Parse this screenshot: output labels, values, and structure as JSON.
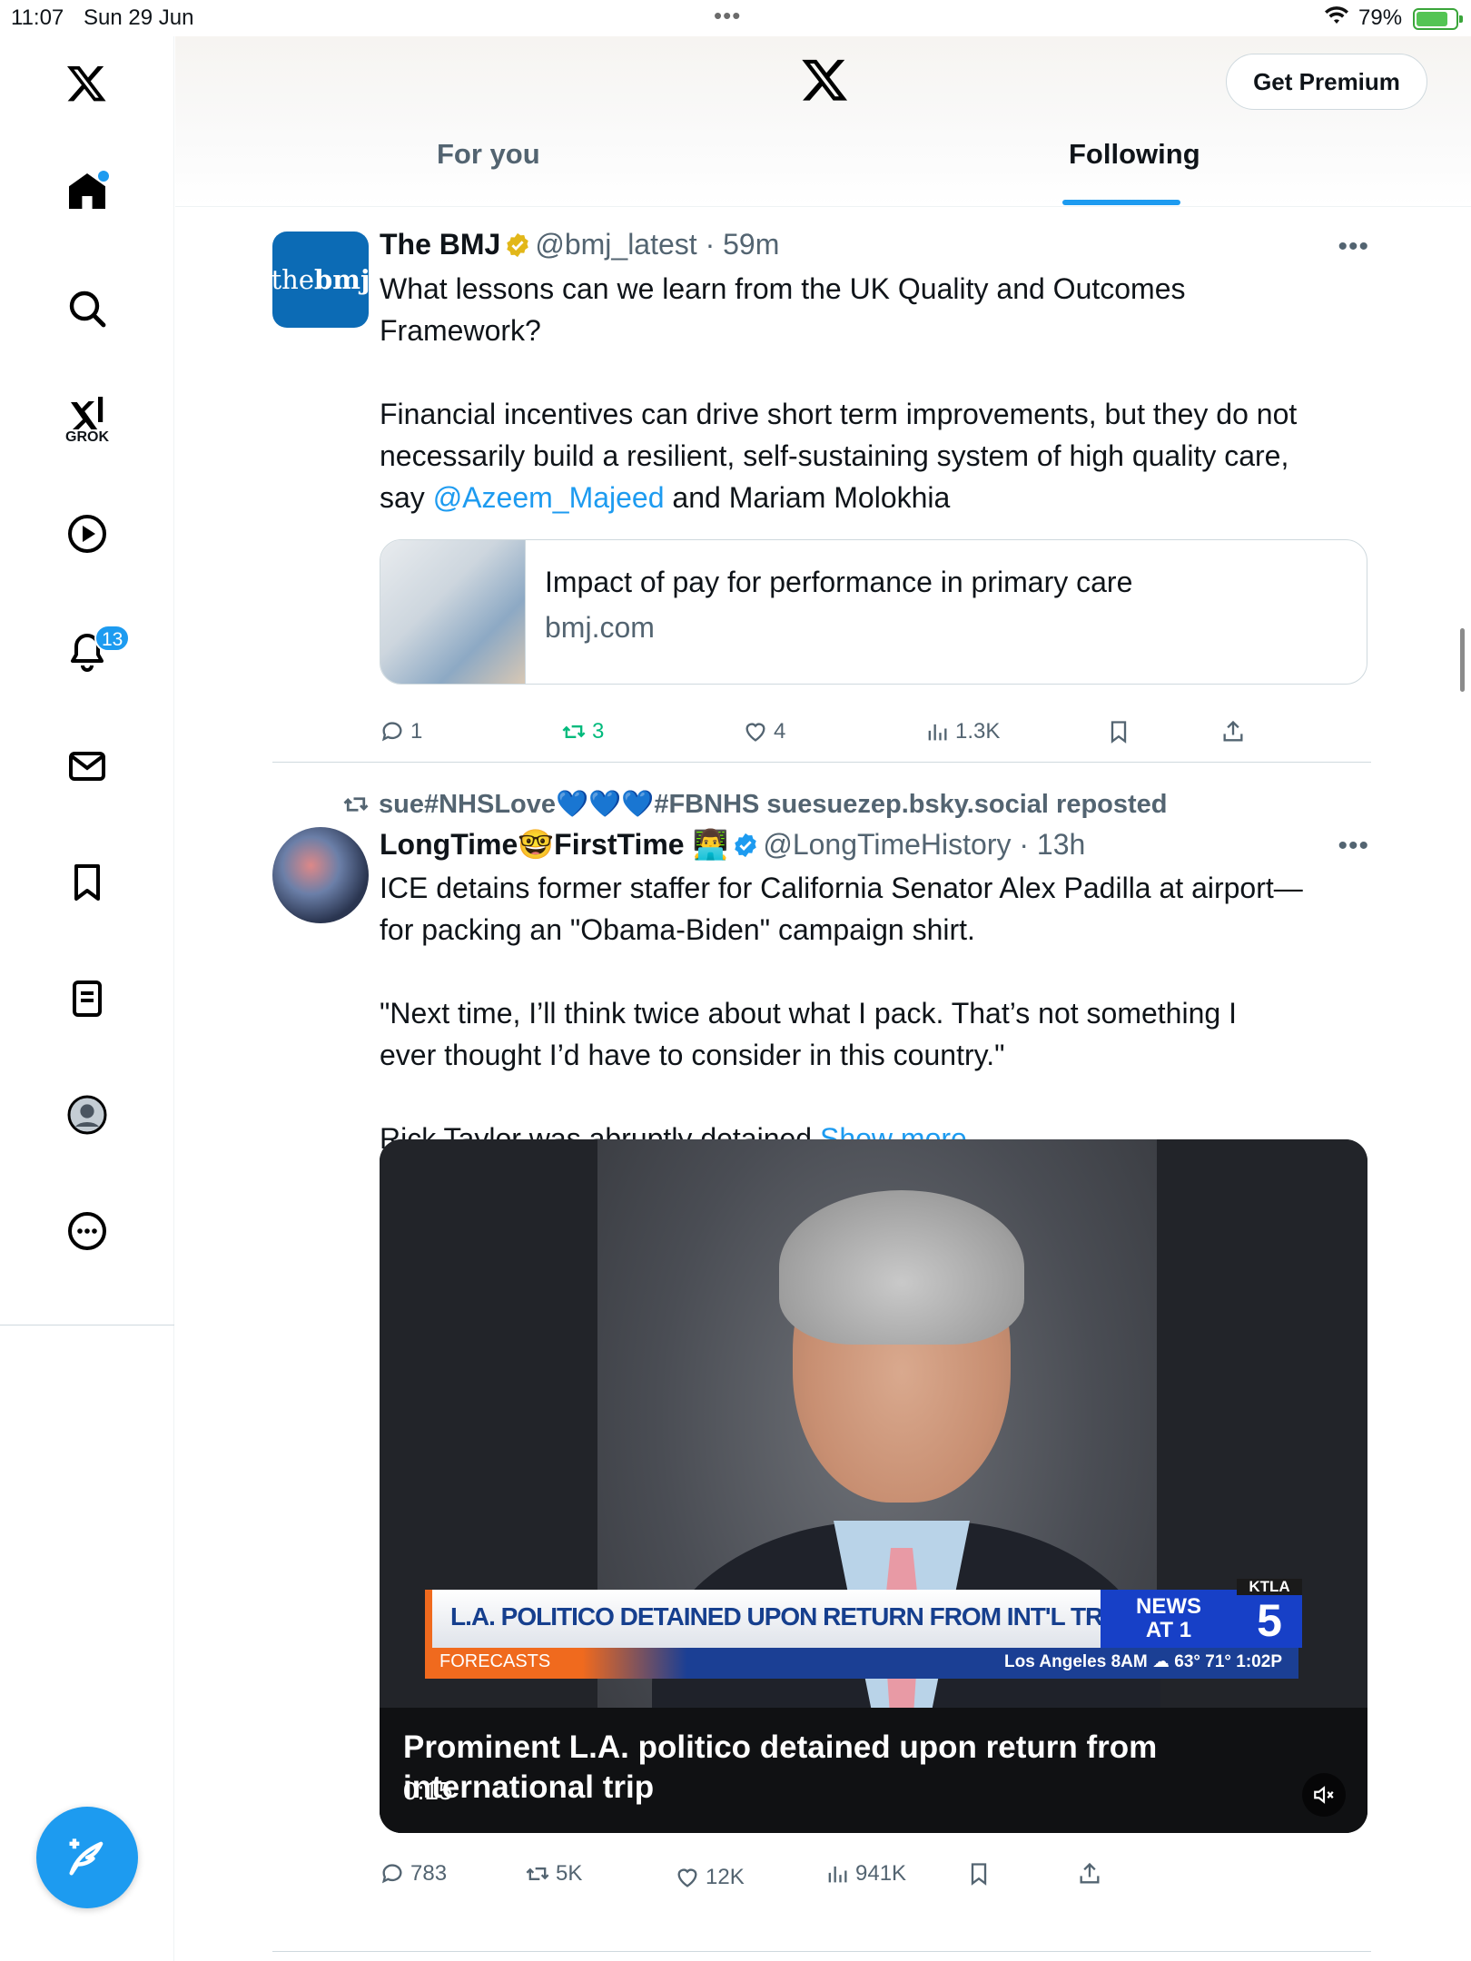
{
  "status_bar": {
    "time": "11:07",
    "date": "Sun 29 Jun",
    "dots": "•••",
    "battery": "79%"
  },
  "sidebar": {
    "notifications_badge": "13",
    "grok_label": "GROK"
  },
  "header": {
    "premium_label": "Get Premium",
    "tabs": [
      {
        "label": "For you"
      },
      {
        "label": "Following"
      }
    ]
  },
  "tweets": [
    {
      "avatar_text_light": "the",
      "avatar_text_bold": "bmj",
      "display_name": "The BMJ",
      "handle_time": "@bmj_latest · 59m",
      "more": "•••",
      "text_1": "What lessons can we learn from the UK Quality and Outcomes\nFramework?\n\nFinancial incentives can drive short term improvements, but they do not\nnecessarily build a resilient, self-sustaining system of high quality care,\nsay ",
      "mention": "@Azeem_Majeed",
      "text_2": " and Mariam Molokhia",
      "card": {
        "title": "Impact of pay for performance in primary care",
        "domain": "bmj.com"
      },
      "stats": {
        "replies": "1",
        "reposts": "3",
        "likes": "4",
        "views": "1.3K"
      }
    },
    {
      "repost_line": "sue#NHSLove💙💙💙#FBNHS suesuezep.bsky.social reposted",
      "display_name_a": "LongTime",
      "display_name_emoji": "🤓",
      "display_name_b": "FirstTime",
      "display_name_emoji2": "👨‍💻",
      "handle_time": "@LongTimeHistory · 13h",
      "more": "•••",
      "text": "ICE detains former staffer for California Senator Alex Padilla at airport—\nfor packing an \"Obama-Biden\" campaign shirt.\n\n\"Next time, I’ll think twice about what I pack. That’s not something I\never thought I’d have to consider in this country.\"\n\nRick Taylor was abruptly detained ",
      "show_more": "Show more",
      "media": {
        "chyron": "L.A. POLITICO DETAINED UPON RETURN FROM INT'L TRIP",
        "chyron_sub": "FORECASTS",
        "weather": "Los Angeles  8AM  ☁  63°   71°   1:02P",
        "news_label": "NEWS\nAT 1",
        "station_small": "KTLA",
        "station_number": "5",
        "caption": "Prominent L.A. politico detained upon return from\ninternational trip",
        "time": "0:15"
      },
      "stats": {
        "replies": "783",
        "reposts": "5K",
        "likes": "12K",
        "views": "941K"
      }
    }
  ]
}
